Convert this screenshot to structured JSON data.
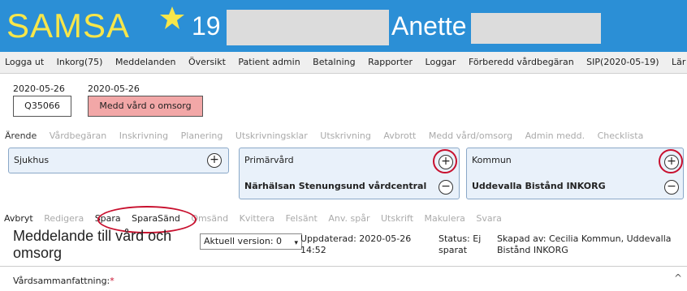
{
  "header": {
    "app_name": "SAMSA",
    "patient_number": "19",
    "patient_name": "Anette"
  },
  "menu": [
    "Logga ut",
    "Inkorg(75)",
    "Meddelanden",
    "Översikt",
    "Patient admin",
    "Betalning",
    "Rapporter",
    "Loggar",
    "Förberedd vårdbegäran",
    "SIP(2020-05-19)",
    "Lär"
  ],
  "cards": {
    "date1": "2020-05-26",
    "id": "Q35066",
    "date2": "2020-05-26",
    "message_type": "Medd vård o omsorg"
  },
  "tabs": [
    "Ärende",
    "Vårdbegäran",
    "Inskrivning",
    "Planering",
    "Utskrivningsklar",
    "Utskrivning",
    "Avbrott",
    "Medd vård/omsorg",
    "Admin medd.",
    "Checklista"
  ],
  "panels": {
    "sjukhus": {
      "title": "Sjukhus"
    },
    "primarvard": {
      "title": "Primärvård",
      "unit": "Närhälsan Stenungsund vårdcentral"
    },
    "kommun": {
      "title": "Kommun",
      "unit": "Uddevalla Bistånd INKORG"
    }
  },
  "toolbar": [
    "Avbryt",
    "Redigera",
    "Spara",
    "SparaSänd",
    "Omsänd",
    "Kvittera",
    "Felsänt",
    "Anv. spår",
    "Utskrift",
    "Makulera",
    "Svara"
  ],
  "message": {
    "title": "Meddelande till vård och omsorg",
    "version": "Aktuell version: 0",
    "updated": "Uppdaterad: 2020-05-26 14:52",
    "status": "Status: Ej sparat",
    "created_by": "Skapad av: Cecilia Kommun, Uddevalla Bistånd INKORG"
  },
  "summary": {
    "label": "Vårdsammanfattning:",
    "required_mark": "*"
  },
  "colors": {
    "header_bg": "#2b8fd6",
    "logo": "#f7e64a",
    "message_type_bg": "#f2a7a7",
    "annotation_ring": "#c8102e"
  },
  "icons": {
    "favorite": "star-icon",
    "add": "plus-circle-icon",
    "remove": "minus-circle-icon",
    "dropdown": "chevron-down-icon",
    "scroll": "chevron-up-icon"
  }
}
